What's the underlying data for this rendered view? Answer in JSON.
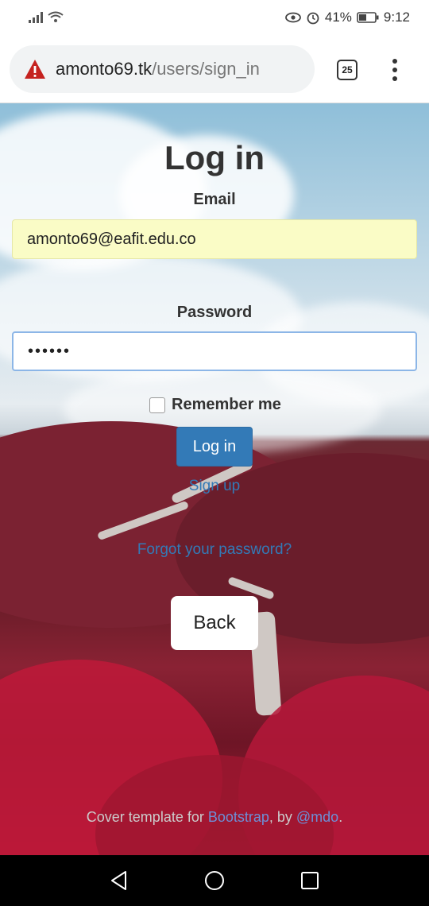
{
  "status_bar": {
    "battery": "41%",
    "time": "9:12"
  },
  "browser": {
    "url_host": "amonto69.tk",
    "url_path": "/users/sign_in",
    "tab_count": "25"
  },
  "form": {
    "title": "Log in",
    "email_label": "Email",
    "email_value": "amonto69@eafit.edu.co",
    "password_label": "Password",
    "password_value": "••••••",
    "remember_label": "Remember me",
    "submit_label": "Log in",
    "signup_link": "Sign up",
    "forgot_link": "Forgot your password?",
    "back_label": "Back"
  },
  "footer": {
    "prefix": "Cover template for ",
    "bootstrap_link": "Bootstrap",
    "middle": ", by ",
    "author_link": "@mdo",
    "suffix": "."
  },
  "colors": {
    "primary": "#337ab7",
    "autofill": "#fafcc6",
    "warning": "#c5221f"
  }
}
